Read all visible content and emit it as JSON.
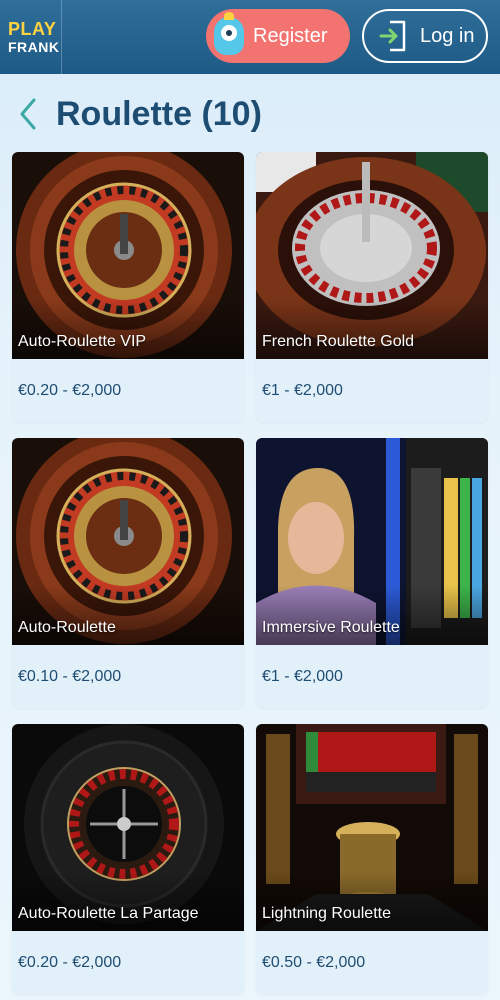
{
  "header": {
    "logo_top": "PLAY",
    "logo_bottom": "FRANK",
    "register_label": "Register",
    "login_label": "Log in"
  },
  "page": {
    "title": "Roulette (10)"
  },
  "colors": {
    "header_bg": "#1e5a86",
    "register_bg": "#f27370",
    "logo_accent": "#ffd23f",
    "card_bg": "#e2f0fa",
    "title_color": "#1e4d73"
  },
  "games": [
    {
      "name": "Auto-Roulette VIP",
      "limits": "€0.20 - €2,000",
      "thumb": "wood-wheel"
    },
    {
      "name": "French Roulette Gold",
      "limits": "€1 - €2,000",
      "thumb": "red-table-wheel"
    },
    {
      "name": "Auto-Roulette",
      "limits": "€0.10 - €2,000",
      "thumb": "wood-wheel"
    },
    {
      "name": "Immersive Roulette",
      "limits": "€1 - €2,000",
      "thumb": "dealer-studio"
    },
    {
      "name": "Auto-Roulette La Partage",
      "limits": "€0.20 - €2,000",
      "thumb": "dark-wheel"
    },
    {
      "name": "Lightning Roulette",
      "limits": "€0.50 - €2,000",
      "thumb": "lightning-studio"
    }
  ]
}
